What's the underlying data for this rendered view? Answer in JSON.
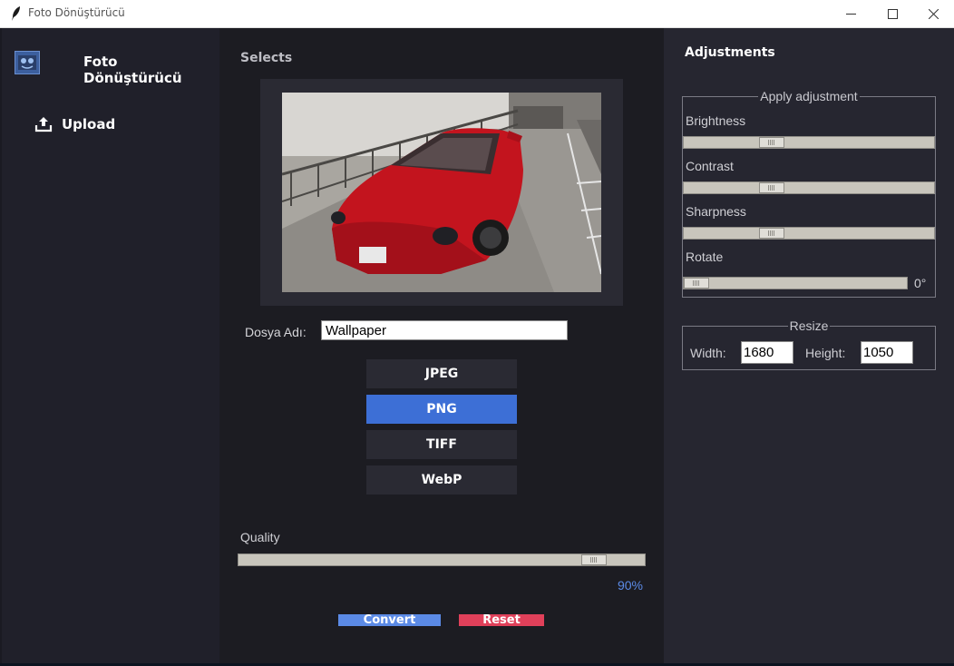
{
  "window": {
    "title": "Foto Dönüştürücü"
  },
  "sidebar": {
    "app_name": "Foto Dönüştürücü",
    "upload_label": "Upload"
  },
  "center": {
    "selects_label": "Selects",
    "filename_label": "Dosya Adı:",
    "filename_value": "Wallpaper",
    "formats": [
      "JPEG",
      "PNG",
      "TIFF",
      "WebP"
    ],
    "active_format": "PNG",
    "quality_label": "Quality",
    "quality_value": "90%",
    "quality_level": 0.9,
    "convert_label": "Convert",
    "reset_label": "Reset"
  },
  "adjustments": {
    "title": "Adjustments",
    "group_label": "Apply adjustment",
    "brightness_label": "Brightness",
    "contrast_label": "Contrast",
    "sharpness_label": "Sharpness",
    "rotate_label": "Rotate",
    "rotate_value": "0°",
    "resize_group_label": "Resize",
    "width_label": "Width:",
    "width_value": "1680",
    "height_label": "Height:",
    "height_value": "1050"
  },
  "colors": {
    "accent": "#3d6fd6",
    "convert": "#5b8ae6",
    "reset": "#e0405a"
  }
}
